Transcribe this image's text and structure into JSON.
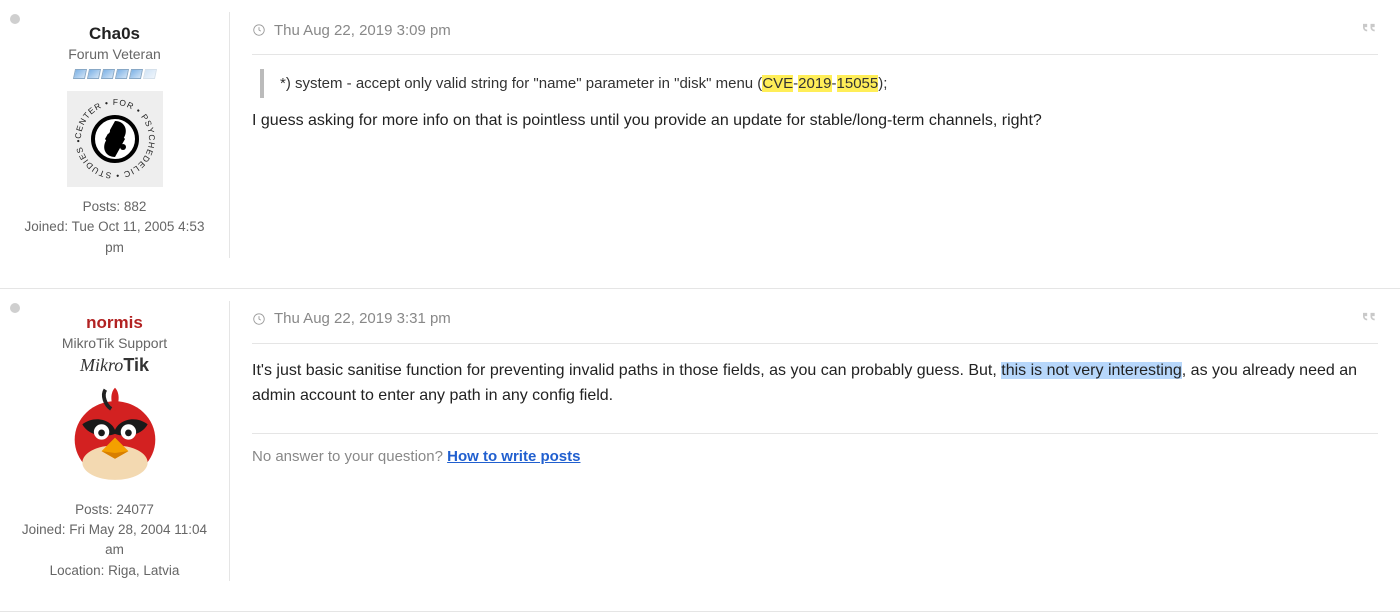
{
  "posts": [
    {
      "username": "Cha0s",
      "rank": "Forum Veteran",
      "posts_label": "Posts:",
      "posts": "882",
      "joined_label": "Joined:",
      "joined": "Tue Oct 11, 2005 4:53 pm",
      "date": "Thu Aug 22, 2019 3:09 pm",
      "quote_pre": "*) system - accept only valid string for \"name\" parameter in \"disk\" menu (",
      "hl1": "CVE",
      "sep1": "-",
      "hl2": "2019",
      "sep2": "-",
      "hl3": "15055",
      "quote_post": ");",
      "body": "I guess asking for more info on that is pointless until you provide an update for stable/long-term channels, right?"
    },
    {
      "username": "normis",
      "rank": "MikroTik Support",
      "brand_a": "Mikro",
      "brand_b": "Tik",
      "posts_label": "Posts:",
      "posts": "24077",
      "joined_label": "Joined:",
      "joined": "Fri May 28, 2004 11:04 am",
      "location_label": "Location:",
      "location": "Riga, Latvia",
      "date": "Thu Aug 22, 2019 3:31 pm",
      "body_a": "It's just basic sanitise function for preventing invalid paths in those fields, as you can probably guess. But, ",
      "body_sel": "this is not very interesting",
      "body_b": ", as you already need an admin account to enter any path in any config field.",
      "sig_text": "No answer to your question? ",
      "sig_link": "How to write posts"
    }
  ]
}
